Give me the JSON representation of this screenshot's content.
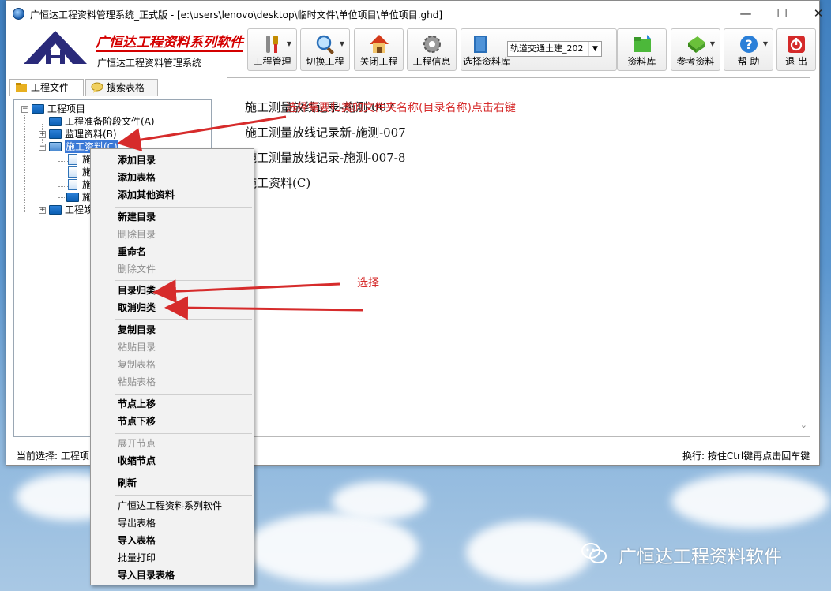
{
  "window": {
    "title": "广恒达工程资料管理系统_正式版 - [e:\\users\\lenovo\\desktop\\临时文件\\单位项目\\单位项目.ghd]",
    "minimize": "—",
    "maximize": "☐",
    "close": "✕"
  },
  "logo": {
    "title": "广恒达工程资料系列软件",
    "subtitle": "广恒达工程资料管理系统"
  },
  "toolbar": {
    "project_mgmt": "工程管理",
    "switch_project": "切换工程",
    "close_project": "关闭工程",
    "project_info": "工程信息",
    "select_library": "选择资料库",
    "library_select_value": "轨道交通土建_202",
    "library": "资料库",
    "reference": "参考资料",
    "help": "帮 助",
    "exit": "退 出"
  },
  "tabs": [
    {
      "label": "工程文件"
    },
    {
      "label": "搜索表格"
    }
  ],
  "tree": {
    "root": "工程项目",
    "items": [
      {
        "label": "工程准备阶段文件(A)"
      },
      {
        "label": "监理资料(B)"
      },
      {
        "label": "施工资料(C)"
      }
    ],
    "children": [
      {
        "label": "施"
      },
      {
        "label": "施"
      },
      {
        "label": "施"
      },
      {
        "label": "施"
      }
    ],
    "last": {
      "label": "工程竣"
    }
  },
  "content": {
    "items": [
      "施工测量放线记录-施测-007",
      "施工测量放线记录新-施测-007",
      "施工测量放线记录-施测-007-8",
      "施工资料(C)"
    ]
  },
  "status": {
    "left": "当前选择: 工程项",
    "right": "换行: 按住Ctrl键再点击回车键"
  },
  "context_menu": {
    "items": [
      {
        "label": "添加目录"
      },
      {
        "label": "添加表格"
      },
      {
        "label": "添加其他资料"
      },
      {
        "label": "新建目录"
      },
      {
        "label": "删除目录"
      },
      {
        "label": "重命名"
      },
      {
        "label": "删除文件"
      },
      {
        "label": "目录归类"
      },
      {
        "label": "取消归类"
      },
      {
        "label": "复制目录"
      },
      {
        "label": "粘贴目录"
      },
      {
        "label": "复制表格"
      },
      {
        "label": "粘贴表格"
      },
      {
        "label": "节点上移"
      },
      {
        "label": "节点下移"
      },
      {
        "label": "展开节点"
      },
      {
        "label": "收缩节点"
      },
      {
        "label": "刷新"
      },
      {
        "label": "广恒达工程资料系列软件"
      },
      {
        "label": "导出表格"
      },
      {
        "label": "导入表格"
      },
      {
        "label": "批量打印"
      },
      {
        "label": "导入目录表格"
      }
    ]
  },
  "annotations": {
    "top": "选择需要归类的文件夹名称(目录名称)点击右键",
    "middle": "选择"
  },
  "watermark": {
    "text": "广恒达工程资料软件"
  },
  "colors": {
    "annotation": "#d62b2b",
    "logo_red": "#d40000",
    "selection": "#3a78d6"
  }
}
